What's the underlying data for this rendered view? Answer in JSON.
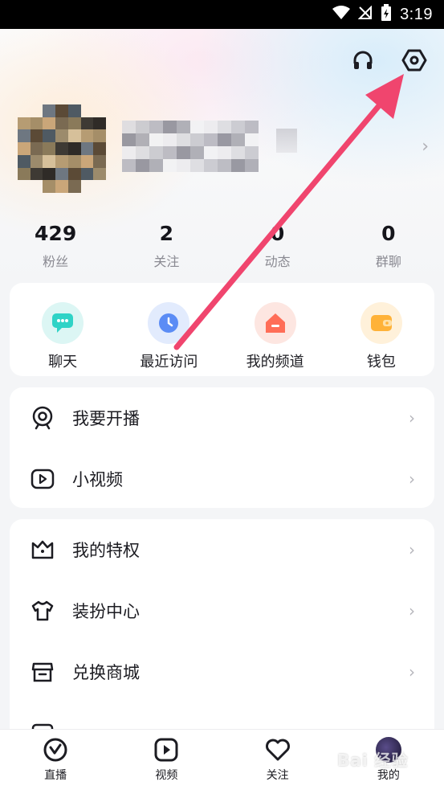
{
  "status_bar": {
    "time": "3:19"
  },
  "header": {
    "headphones_icon": "headphones-icon",
    "settings_icon": "settings-hexagon-icon"
  },
  "profile": {
    "chevron": "›"
  },
  "stats": [
    {
      "num": "429",
      "label": "粉丝"
    },
    {
      "num": "2",
      "label": "关注"
    },
    {
      "num": "0",
      "label": "动态"
    },
    {
      "num": "0",
      "label": "群聊"
    }
  ],
  "quick_actions": [
    {
      "label": "聊天",
      "icon": "chat-bubble-icon",
      "color": "#2fd3c6"
    },
    {
      "label": "最近访问",
      "icon": "clock-icon",
      "color": "#5b8cf5"
    },
    {
      "label": "我的频道",
      "icon": "home-channel-icon",
      "color": "#ff6d57"
    },
    {
      "label": "钱包",
      "icon": "wallet-icon",
      "color": "#ffb238"
    }
  ],
  "menu_group1": [
    {
      "label": "我要开播",
      "icon": "webcam-icon"
    },
    {
      "label": "小视频",
      "icon": "play-video-icon"
    }
  ],
  "menu_group2": [
    {
      "label": "我的特权",
      "icon": "crown-icon"
    },
    {
      "label": "装扮中心",
      "icon": "tshirt-icon"
    },
    {
      "label": "兑换商城",
      "icon": "shop-icon"
    },
    {
      "label": "",
      "icon": "more-icon"
    }
  ],
  "chevron": "›",
  "tabbar": [
    {
      "label": "直播",
      "icon": "live-icon"
    },
    {
      "label": "视频",
      "icon": "video-icon"
    },
    {
      "label": "关注",
      "icon": "heart-icon"
    },
    {
      "label": "我的",
      "icon": "avatar"
    }
  ],
  "watermark": "Bai 经验",
  "colors": {
    "accent_arrow": "#f0456e",
    "background": "#f4f5f7"
  }
}
